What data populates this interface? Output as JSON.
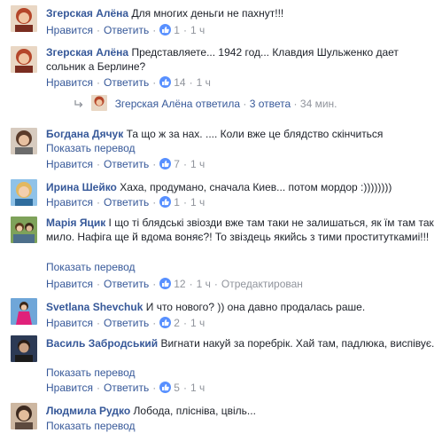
{
  "ui": {
    "like": "Нравится",
    "reply": "Ответить",
    "translate": "Показать перевод",
    "edited": "Отредактирован"
  },
  "colors": {
    "link": "#365899",
    "meta": "#90949c",
    "like_bubble": "#5890ff"
  },
  "comments": [
    {
      "author": "Згерская Алёна",
      "text": "Для многих деньги не пахнут!!!",
      "translate": false,
      "likes": "1",
      "time": "1 ч",
      "avatar": "woman-red-hair"
    },
    {
      "author": "Згерская Алёна",
      "text": "Представляете... 1942 год... Клавдия Шульженко дает сольник а Берлине?",
      "translate": false,
      "likes": "14",
      "time": "1 ч",
      "avatar": "woman-red-hair"
    },
    {
      "author": "Богдана Дячук",
      "text": "Та що ж за нах. .... Коли вже це блядство скінчиться",
      "translate": true,
      "likes": "7",
      "time": "1 ч",
      "avatar": "woman-brown-hair"
    },
    {
      "author": "Ирина Шейко",
      "text": "Хаха, продумано, сначала Киев... потом мордор :))))))))",
      "translate": false,
      "likes": "1",
      "time": "1 ч",
      "avatar": "woman-blonde-sun"
    },
    {
      "author": "Марія Яцик",
      "text": "І що ті блядські звіозди вже там таки не залишаться, як їм там так мило. Нафіга ще й вдома воняє?! То звіздець якийсь з тими проституткамиi!!!",
      "translate": true,
      "likes": "12",
      "time": "1 ч",
      "edited": true,
      "avatar": "couple-outdoor"
    },
    {
      "author": "Svetlana Shevchuk",
      "text": "И что нового? )) она давно продалась раше.",
      "translate": false,
      "likes": "2",
      "time": "1 ч",
      "avatar": "woman-pink-dress"
    },
    {
      "author": "Василь Забродський",
      "text": "Вигнати накуй за поребрік. Хай там, падлюка, виспівує.",
      "translate": true,
      "likes": "5",
      "time": "1 ч",
      "avatar": "man-dark-portrait"
    },
    {
      "author": "Людмила Рудко",
      "text": "Лобода, плісніва, цвіль...",
      "translate": true,
      "avatar": "woman-dark-hair"
    }
  ],
  "reply_summary": {
    "author": "Згерская Алёна",
    "verb": "ответила",
    "count": "3 ответа",
    "time": "34 мин."
  }
}
